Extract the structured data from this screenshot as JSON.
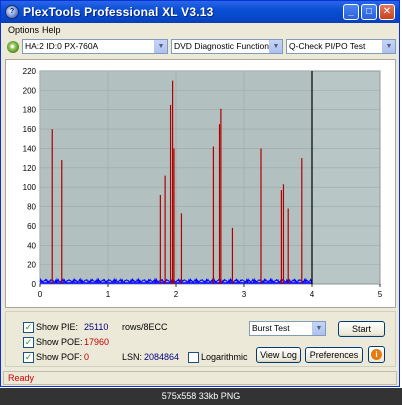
{
  "window": {
    "title": "PlexTools Professional XL V3.13",
    "icon_text": "?"
  },
  "titlebar_buttons": {
    "minimize": "_",
    "maximize": "□",
    "close": "✕"
  },
  "menu": {
    "items": [
      "Options",
      "Help"
    ]
  },
  "toolbar": {
    "drive": "HA:2 ID:0  PX-760A",
    "function": "DVD Diagnostic Functions",
    "test": "Q-Check PI/PO Test"
  },
  "chart_data": {
    "type": "bar",
    "background_color": "#b9c6c6",
    "tested_region_color": "#b3c0c0",
    "pie_color": "#b00000",
    "pif_color": "#0000ff",
    "x_ticks": [
      "0",
      "1",
      "2",
      "3",
      "4",
      "5"
    ],
    "y_ticks": [
      "0",
      "20",
      "40",
      "60",
      "80",
      "100",
      "120",
      "140",
      "160",
      "180",
      "200",
      "220"
    ],
    "xlim": [
      0,
      5
    ],
    "ylim": [
      0,
      220
    ],
    "grid": true,
    "end_marker_x": 4.0,
    "pie_spikes": [
      {
        "x": 0.18,
        "y": 160
      },
      {
        "x": 0.32,
        "y": 128
      },
      {
        "x": 1.77,
        "y": 92
      },
      {
        "x": 1.84,
        "y": 112
      },
      {
        "x": 1.92,
        "y": 185
      },
      {
        "x": 1.95,
        "y": 210
      },
      {
        "x": 1.97,
        "y": 140
      },
      {
        "x": 2.08,
        "y": 73
      },
      {
        "x": 2.55,
        "y": 142
      },
      {
        "x": 2.64,
        "y": 165
      },
      {
        "x": 2.66,
        "y": 181
      },
      {
        "x": 2.83,
        "y": 58
      },
      {
        "x": 3.25,
        "y": 140
      },
      {
        "x": 3.55,
        "y": 97
      },
      {
        "x": 3.58,
        "y": 103
      },
      {
        "x": 3.65,
        "y": 78
      },
      {
        "x": 3.85,
        "y": 130
      }
    ]
  },
  "controls": {
    "show_pie_label": "Show PIE:",
    "pie_value": "25110",
    "units": "rows/8ECC",
    "show_poe_label": "Show POE:",
    "poe_value": "17960",
    "show_pof_label": "Show POF:",
    "pof_value": "0",
    "lsn_label": "LSN:",
    "lsn_value": "2084864",
    "logarithmic_label": "Logarithmic",
    "mode": "Burst Test",
    "start_button": "Start",
    "view_log_button": "View Log",
    "preferences_button": "Preferences",
    "info_glyph": "i",
    "check_glyph": "✓",
    "pie_color": "#000080",
    "poe_color": "#c00000"
  },
  "status": {
    "text": "Ready"
  },
  "caption": "575x558 33kb PNG"
}
